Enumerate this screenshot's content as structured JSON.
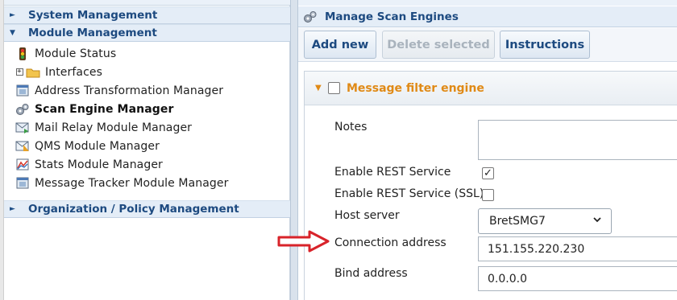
{
  "left_panel": {
    "sections": {
      "system_management": "System Management",
      "module_management": "Module Management",
      "org_policy_management": "Organization / Policy Management"
    },
    "items": [
      {
        "label": "Module Status",
        "icon": "traffic-light-icon"
      },
      {
        "label": "Interfaces",
        "icon": "folder-icon"
      },
      {
        "label": "Address Transformation Manager",
        "icon": "module-window-icon"
      },
      {
        "label": "Scan Engine Manager",
        "icon": "gears-icon"
      },
      {
        "label": "Mail Relay Module Manager",
        "icon": "mail-relay-icon"
      },
      {
        "label": "QMS Module Manager",
        "icon": "qms-icon"
      },
      {
        "label": "Stats Module Manager",
        "icon": "stats-icon"
      },
      {
        "label": "Message Tracker Module Manager",
        "icon": "module-window-icon"
      }
    ]
  },
  "right_panel": {
    "title": "Manage Scan Engines",
    "toolbar": {
      "add_new": "Add new",
      "delete_selected": "Delete selected",
      "instructions": "Instructions"
    },
    "engine": {
      "title": "Message filter engine",
      "fields": {
        "notes_label": "Notes",
        "notes_value": "",
        "rest_label": "Enable REST Service",
        "rest_checked": true,
        "rest_ssl_label": "Enable REST Service (SSL)",
        "rest_ssl_checked": false,
        "host_label": "Host server",
        "host_value": "BretSMG7",
        "connection_label": "Connection address",
        "connection_value": "151.155.220.230",
        "bind_label": "Bind address",
        "bind_value": "0.0.0.0"
      }
    }
  },
  "colors": {
    "header_text": "#1d4a80",
    "engine_title": "#e08a16",
    "annotation_arrow": "#d8232a"
  }
}
